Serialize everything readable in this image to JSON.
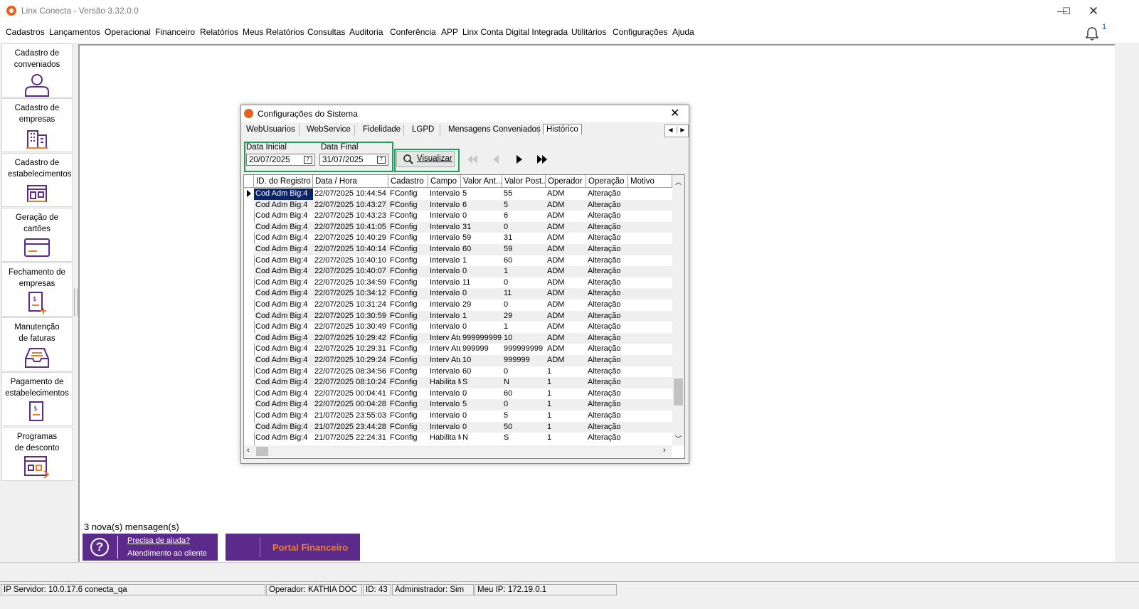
{
  "window": {
    "title": "Linx Conecta - Versão 3.32.0.0"
  },
  "menu": [
    "Cadastros",
    "Lançamentos",
    "Operacional",
    "Financeiro",
    "Relatórios",
    "Meus Relatórios",
    "Consultas",
    "Auditoria",
    "Conferência",
    "APP",
    "Linx Conta Digital Integrada",
    "Utilitários",
    "Configurações",
    "Ajuda"
  ],
  "notifications": {
    "count": "1"
  },
  "sidebar": [
    {
      "label": "Cadastro de conveniados",
      "icon": "user-icon"
    },
    {
      "label": "Cadastro de empresas",
      "icon": "building-icon"
    },
    {
      "label": "Cadastro de estabelecimentos",
      "icon": "store-icon"
    },
    {
      "label": "Geração de cartões",
      "icon": "card-icon"
    },
    {
      "label": "Fechamento de empresas",
      "icon": "invoice-add-icon"
    },
    {
      "label": "Manutenção de faturas",
      "icon": "inbox-icon"
    },
    {
      "label": "Pagamento de estabelecimentos",
      "icon": "payment-icon"
    },
    {
      "label": "Programas de desconto",
      "icon": "discount-icon"
    }
  ],
  "dialog": {
    "title": "Configurações do Sistema",
    "tabs": [
      "WebUsuarios",
      "WebService",
      "Fidelidade",
      "LGPD",
      "Mensagens Conveniados",
      "Histórico"
    ],
    "active_tab": "Histórico",
    "filter": {
      "start_label": "Data Inicial",
      "start_value": "20/07/2025",
      "end_label": "Data Final",
      "end_value": "31/07/2025",
      "button_label": "Visualizar"
    },
    "grid": {
      "columns": [
        "ID. do Registro",
        "Data / Hora",
        "Cadastro",
        "Campo",
        "Valor Ant...",
        "Valor Post...",
        "Operador",
        "Operação",
        "Motivo"
      ],
      "rows": [
        [
          "Cod Adm Big:4",
          "22/07/2025 10:44:54",
          "FConfig",
          "Intervalo",
          "5",
          "55",
          "ADM",
          "Alteração",
          ""
        ],
        [
          "Cod Adm Big:4",
          "22/07/2025 10:43:27",
          "FConfig",
          "Intervalo",
          "6",
          "5",
          "ADM",
          "Alteração",
          ""
        ],
        [
          "Cod Adm Big:4",
          "22/07/2025 10:43:23",
          "FConfig",
          "Intervalo",
          "0",
          "6",
          "ADM",
          "Alteração",
          ""
        ],
        [
          "Cod Adm Big:4",
          "22/07/2025 10:41:05",
          "FConfig",
          "Intervalo",
          "31",
          "0",
          "ADM",
          "Alteração",
          ""
        ],
        [
          "Cod Adm Big:4",
          "22/07/2025 10:40:29",
          "FConfig",
          "Intervalo",
          "59",
          "31",
          "ADM",
          "Alteração",
          ""
        ],
        [
          "Cod Adm Big:4",
          "22/07/2025 10:40:14",
          "FConfig",
          "Intervalo",
          "60",
          "59",
          "ADM",
          "Alteração",
          ""
        ],
        [
          "Cod Adm Big:4",
          "22/07/2025 10:40:10",
          "FConfig",
          "Intervalo",
          "1",
          "60",
          "ADM",
          "Alteração",
          ""
        ],
        [
          "Cod Adm Big:4",
          "22/07/2025 10:40:07",
          "FConfig",
          "Intervalo",
          "0",
          "1",
          "ADM",
          "Alteração",
          ""
        ],
        [
          "Cod Adm Big:4",
          "22/07/2025 10:34:59",
          "FConfig",
          "Intervalo",
          "11",
          "0",
          "ADM",
          "Alteração",
          ""
        ],
        [
          "Cod Adm Big:4",
          "22/07/2025 10:34:12",
          "FConfig",
          "Intervalo",
          "0",
          "11",
          "ADM",
          "Alteração",
          ""
        ],
        [
          "Cod Adm Big:4",
          "22/07/2025 10:31:24",
          "FConfig",
          "Intervalo",
          "29",
          "0",
          "ADM",
          "Alteração",
          ""
        ],
        [
          "Cod Adm Big:4",
          "22/07/2025 10:30:59",
          "FConfig",
          "Intervalo",
          "1",
          "29",
          "ADM",
          "Alteração",
          ""
        ],
        [
          "Cod Adm Big:4",
          "22/07/2025 10:30:49",
          "FConfig",
          "Intervalo",
          "0",
          "1",
          "ADM",
          "Alteração",
          ""
        ],
        [
          "Cod Adm Big:4",
          "22/07/2025 10:29:42",
          "FConfig",
          "Interv Atu",
          "999999999",
          "10",
          "ADM",
          "Alteração",
          ""
        ],
        [
          "Cod Adm Big:4",
          "22/07/2025 10:29:31",
          "FConfig",
          "Interv Atu",
          "999999",
          "999999999",
          "ADM",
          "Alteração",
          ""
        ],
        [
          "Cod Adm Big:4",
          "22/07/2025 10:29:24",
          "FConfig",
          "Interv Atu",
          "10",
          "999999",
          "ADM",
          "Alteração",
          ""
        ],
        [
          "Cod Adm Big:4",
          "22/07/2025 08:34:56",
          "FConfig",
          "Intervalo",
          "60",
          "0",
          "1",
          "Alteração",
          ""
        ],
        [
          "Cod Adm Big:4",
          "22/07/2025 08:10:24",
          "FConfig",
          "Habilita M",
          "S",
          "N",
          "1",
          "Alteração",
          ""
        ],
        [
          "Cod Adm Big:4",
          "22/07/2025 00:04:41",
          "FConfig",
          "Intervalo",
          "0",
          "60",
          "1",
          "Alteração",
          ""
        ],
        [
          "Cod Adm Big:4",
          "22/07/2025 00:04:28",
          "FConfig",
          "Intervalo",
          "5",
          "0",
          "1",
          "Alteração",
          ""
        ],
        [
          "Cod Adm Big:4",
          "21/07/2025 23:55:03",
          "FConfig",
          "Intervalo",
          "0",
          "5",
          "1",
          "Alteração",
          ""
        ],
        [
          "Cod Adm Big:4",
          "21/07/2025 23:44:28",
          "FConfig",
          "Intervalo",
          "0",
          "50",
          "1",
          "Alteração",
          ""
        ],
        [
          "Cod Adm Big:4",
          "21/07/2025 22:24:31",
          "FConfig",
          "Habilita M",
          "N",
          "S",
          "1",
          "Alteração",
          ""
        ]
      ]
    }
  },
  "messages": {
    "text": "3 nova(s) mensagen(s)"
  },
  "help": {
    "line1": "Precisa de ajuda?",
    "line2": "Atendimento ao cliente"
  },
  "portal": {
    "label": "Portal Financeiro"
  },
  "status": {
    "server": "IP Servidor: 10.0.17.6 conecta_qa",
    "operator": "Operador: KATHIA DOC",
    "id": "ID: 43",
    "admin": "Administrador: Sim",
    "ip": "Meu IP: 172.19.0.1"
  },
  "colors": {
    "accent_purple": "#5b2a8b",
    "accent_orange": "#f07d22",
    "highlight_green": "#19a05a",
    "selection": "#0a246a"
  }
}
